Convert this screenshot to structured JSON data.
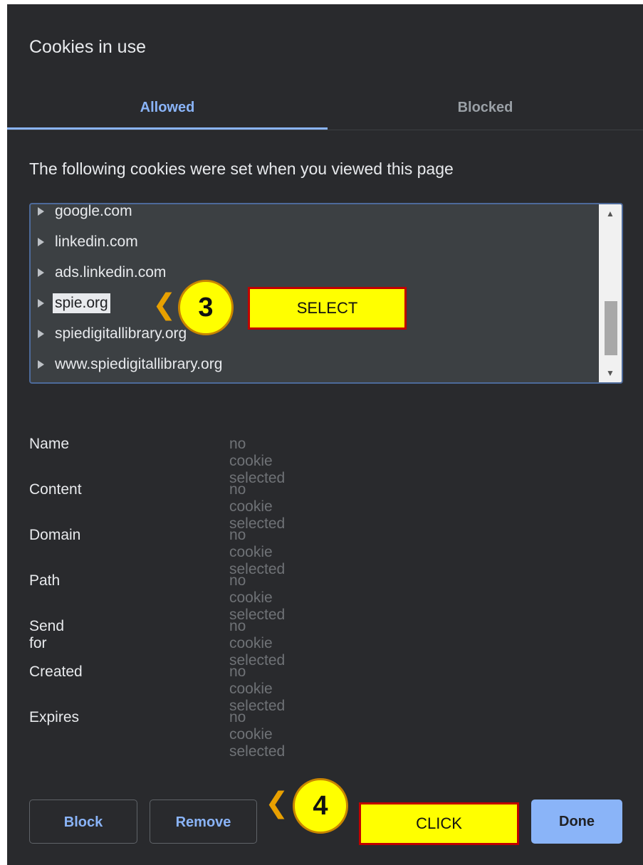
{
  "dialog": {
    "title": "Cookies in use",
    "tabs": [
      {
        "label": "Allowed",
        "active": true
      },
      {
        "label": "Blocked",
        "active": false
      }
    ],
    "description": "The following cookies were set when you viewed this page",
    "tree": {
      "items": [
        {
          "label": "google.com"
        },
        {
          "label": "linkedin.com"
        },
        {
          "label": "ads.linkedin.com"
        },
        {
          "label": "spie.org",
          "selected": true
        },
        {
          "label": "spiedigitallibrary.org"
        },
        {
          "label": "www.spiedigitallibrary.org"
        }
      ]
    },
    "details": [
      {
        "key": "Name",
        "value": "no cookie selected"
      },
      {
        "key": "Content",
        "value": "no cookie selected"
      },
      {
        "key": "Domain",
        "value": "no cookie selected"
      },
      {
        "key": "Path",
        "value": "no cookie selected"
      },
      {
        "key": "Send for",
        "value": "no cookie selected"
      },
      {
        "key": "Created",
        "value": "no cookie selected"
      },
      {
        "key": "Expires",
        "value": "no cookie selected"
      }
    ],
    "buttons": {
      "block": "Block",
      "remove": "Remove",
      "done": "Done"
    }
  },
  "annotations": {
    "step3": {
      "number": "3",
      "label": "SELECT"
    },
    "step4": {
      "number": "4",
      "label": "CLICK"
    }
  },
  "colors": {
    "background": "#292a2d",
    "accent": "#8ab4f8",
    "annotation_fill": "#ffff00",
    "annotation_border": "#c00000"
  }
}
